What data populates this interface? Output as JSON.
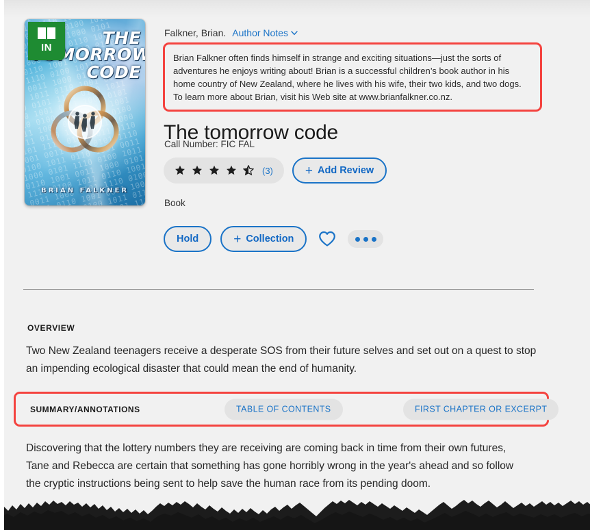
{
  "cover": {
    "title_line1": "THE TOMORROW",
    "title_line2": "CODE",
    "author": "BRIAN FALKNER",
    "availability_badge": "IN",
    "badge_icon": "open-book-icon",
    "badge_color": "#1e8b32",
    "digits_pattern": "0010 1101 0011 1000 0101 1110 0100 1011 0110 1001"
  },
  "details": {
    "author_byline": "Falkner, Brian.",
    "author_notes_link": "Author Notes",
    "author_notes_text": "Brian Falkner often finds himself in strange and exciting situations—just the sorts of adventures he enjoys writing about! Brian is a successful children’s book author in his home country of New Zealand, where he lives with his wife, their two kids, and two dogs. To learn more about Brian, visit his Web site at www.brianfalkner.co.nz.",
    "title": "The tomorrow code",
    "call_number": "Call Number: FIC FAL",
    "rating_value": 4.5,
    "rating_max": 5,
    "rating_count": "(3)",
    "add_review_label": "Add Review",
    "add_review_plus": "+",
    "format": "Book",
    "hold_label": "Hold",
    "collection_label": "Collection",
    "collection_plus": "+",
    "favorite_icon": "heart-outline-icon",
    "more_icon": "more-horizontal-icon"
  },
  "overview": {
    "label": "OVERVIEW",
    "text": "Two New Zealand teenagers receive a desperate SOS from their future selves and set out on a quest to stop an impending ecological disaster that could mean the end of humanity."
  },
  "summary": {
    "active_tab": "SUMMARY/ANNOTATIONS",
    "tabs": [
      {
        "label": "TABLE OF CONTENTS"
      },
      {
        "label": "FIRST CHAPTER OR EXCERPT"
      }
    ],
    "text": "Discovering that the lottery numbers they are receiving are coming back in time from their own futures, Tane and Rebecca are certain that something has gone horribly wrong in the year's ahead and so follow the cryptic instructions being sent to help save the human race from its pending doom."
  },
  "colors": {
    "page_background": "#f1f1f1",
    "accent_blue": "#1a73c7",
    "annotation_red": "#f4433f",
    "pill_gray": "#e3e3e3",
    "available_green": "#1e8b32",
    "text_dark": "#1b1b1b"
  }
}
